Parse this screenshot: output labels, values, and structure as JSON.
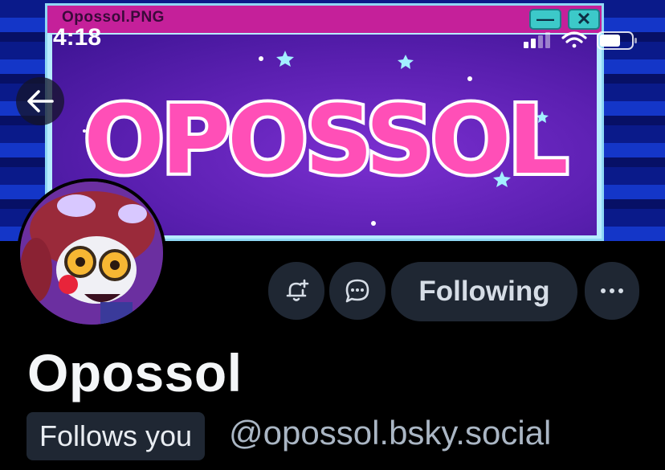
{
  "status_bar": {
    "time": "4:18"
  },
  "banner": {
    "window_title": "Opossol.PNG",
    "minimize_glyph": "—",
    "close_glyph": "✕",
    "logo_text": "OPOSSOL"
  },
  "profile": {
    "display_name": "Opossol",
    "follows_you_label": "Follows you",
    "handle": "@opossol.bsky.social",
    "following_label": "Following",
    "more_label": "···"
  },
  "colors": {
    "background": "#000000",
    "button_bg": "#1f2733",
    "handle_text": "#aab6c4",
    "banner_titlebar": "#c5209a"
  },
  "icons": {
    "back": "arrow-left-icon",
    "notify": "bell-plus-icon",
    "message": "chat-bubble-icon",
    "more": "ellipsis-icon"
  }
}
